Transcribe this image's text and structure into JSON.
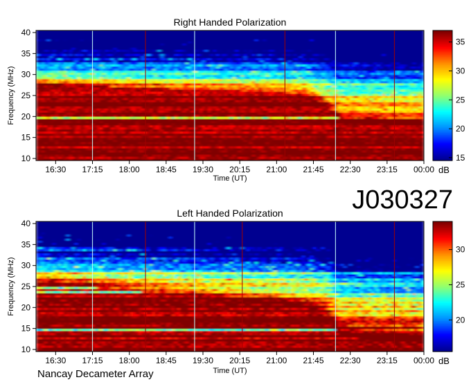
{
  "designation": "J030327",
  "footer": "Nancay Decameter Array",
  "colorscale": [
    "#000090",
    "#0000ff",
    "#0090ff",
    "#00ffff",
    "#90ff70",
    "#ffff00",
    "#ff9000",
    "#ff0000",
    "#800000"
  ],
  "chart_data": [
    {
      "type": "heatmap",
      "title": "Right Handed Polarization",
      "xlabel": "Time (UT)",
      "ylabel": "Frequency (MHz)",
      "x_ticks": [
        "16:30",
        "17:15",
        "18:00",
        "18:45",
        "19:30",
        "20:15",
        "21:00",
        "21:45",
        "22:30",
        "23:15",
        "00:00"
      ],
      "x_range_hours": [
        16.1,
        24.0
      ],
      "ylim": [
        9.5,
        40.5
      ],
      "y_ticks": [
        10,
        15,
        20,
        25,
        30,
        35,
        40
      ],
      "colorbar": {
        "label": "dB",
        "range": [
          14.5,
          37
        ],
        "ticks": [
          15,
          20,
          25,
          30,
          35
        ]
      },
      "intensity_profile_by_frequency_dB": [
        [
          10,
          36
        ],
        [
          15,
          35
        ],
        [
          20,
          33
        ],
        [
          25,
          31
        ],
        [
          30,
          24
        ],
        [
          35,
          19
        ],
        [
          40,
          15
        ]
      ],
      "hot_region_boundary": [
        [
          16.2,
          28
        ],
        [
          18.0,
          27
        ],
        [
          21.0,
          26
        ],
        [
          21.7,
          25
        ],
        [
          22.3,
          19
        ],
        [
          24.0,
          18
        ]
      ],
      "marker_lines_hours": [
        17.25,
        18.33,
        19.33,
        21.17,
        22.2,
        23.4
      ]
    },
    {
      "type": "heatmap",
      "title": "Left Handed Polarization",
      "xlabel": "Time (UT)",
      "ylabel": "Frequency (MHz)",
      "x_ticks": [
        "16:30",
        "17:15",
        "18:00",
        "18:45",
        "19:30",
        "20:15",
        "21:00",
        "21:45",
        "22:30",
        "23:15",
        "00:00"
      ],
      "x_range_hours": [
        16.1,
        24.0
      ],
      "ylim": [
        9.5,
        40.5
      ],
      "y_ticks": [
        10,
        15,
        20,
        25,
        30,
        35,
        40
      ],
      "colorbar": {
        "label": "dB",
        "range": [
          15.5,
          34
        ],
        "ticks": [
          20,
          25,
          30
        ]
      },
      "intensity_profile_by_frequency_dB": [
        [
          10,
          34
        ],
        [
          15,
          33
        ],
        [
          20,
          31
        ],
        [
          25,
          29
        ],
        [
          30,
          25
        ],
        [
          35,
          19
        ],
        [
          40,
          16
        ]
      ],
      "hot_region_boundary": [
        [
          16.2,
          26
        ],
        [
          18.0,
          24
        ],
        [
          21.0,
          21
        ],
        [
          22.0,
          19
        ],
        [
          22.3,
          13
        ],
        [
          24.0,
          12
        ]
      ],
      "marker_lines_hours": [
        17.25,
        18.33,
        19.33,
        20.3,
        22.2,
        23.4
      ]
    }
  ]
}
